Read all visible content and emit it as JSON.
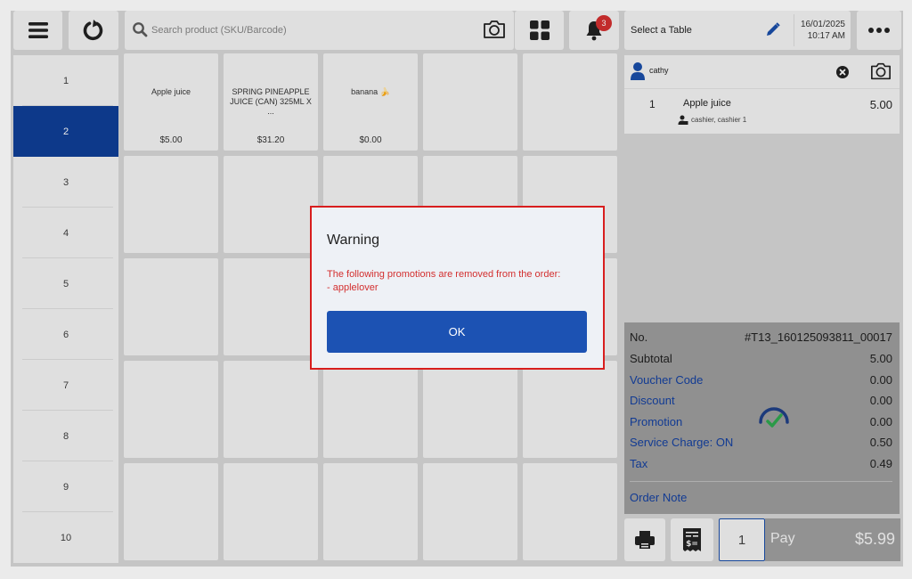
{
  "toolbar": {
    "search_placeholder": "Search product (SKU/Barcode)",
    "notification_count": "3",
    "table_label": "Select a Table",
    "date": "16/01/2025",
    "time": "10:17 AM"
  },
  "categories": [
    "1",
    "2",
    "3",
    "4",
    "5",
    "6",
    "7",
    "8",
    "9",
    "10"
  ],
  "selected_category": "2",
  "products": [
    {
      "name": "Apple juice",
      "price": "$5.00"
    },
    {
      "name": "SPRING PINEAPPLE JUICE (CAN) 325ML X ...",
      "price": "$31.20"
    },
    {
      "name": "banana 🍌",
      "price": "$0.00"
    }
  ],
  "cart": {
    "user": "cathy",
    "items": [
      {
        "qty": "1",
        "name": "Apple juice",
        "price": "5.00",
        "staff": "cashier, cashier 1"
      }
    ]
  },
  "summary": {
    "order_no_label": "No.",
    "order_no": "#T13_160125093811_00017",
    "subtotal_label": "Subtotal",
    "subtotal": "5.00",
    "voucher_label": "Voucher Code",
    "voucher": "0.00",
    "discount_label": "Discount",
    "discount": "0.00",
    "promotion_label": "Promotion",
    "promotion": "0.00",
    "service_label": "Service Charge: ON",
    "service": "0.50",
    "tax_label": "Tax",
    "tax": "0.49",
    "note_label": "Order Note"
  },
  "pay": {
    "qty": "1",
    "label": "Pay",
    "total": "$5.99"
  },
  "dialog": {
    "title": "Warning",
    "message_line1": "The following promotions are removed from the order:",
    "message_line2": "- applelover",
    "ok": "OK"
  },
  "colors": {
    "accent": "#1c52b3",
    "selected_category": "#0f3e96",
    "warning": "#d32f2f",
    "panel": "#f2f2f2",
    "background": "#d6d6d6"
  }
}
